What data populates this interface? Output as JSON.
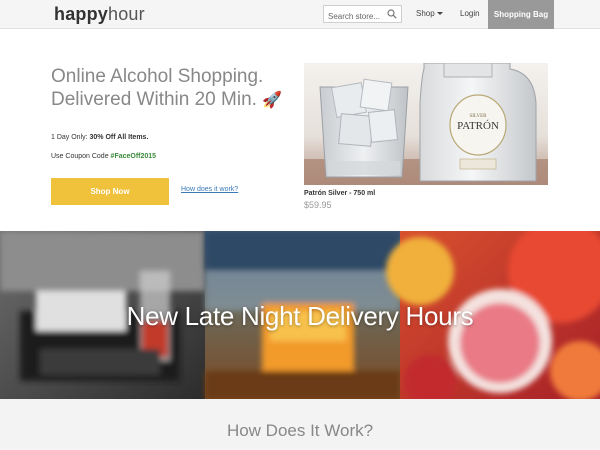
{
  "header": {
    "logo_bold": "happy",
    "logo_rest": "hour",
    "search_placeholder": "Search store...",
    "shop_label": "Shop",
    "login_label": "Login",
    "bag_label": "Shopping Bag"
  },
  "hero": {
    "headline_line1": "Online Alcohol Shopping.",
    "headline_line2": "Delivered Within 20 Min.",
    "rocket": "🚀",
    "promo_prefix": "1 Day Only: ",
    "promo_bold": "30% Off All Items.",
    "coupon_prefix": "Use Coupon Code ",
    "coupon_code": "#FaceOff2015",
    "shop_now_label": "Shop Now",
    "how_link_label": "How does it work?"
  },
  "product": {
    "name": "Patrón Silver - 750 ml",
    "price": "$59.95",
    "bottle_label": "PATRÓN"
  },
  "banner": {
    "title": "New Late Night Delivery Hours"
  },
  "section": {
    "how_title": "How Does It Work?"
  },
  "colors": {
    "accent_yellow": "#f0c13a",
    "bag_gray": "#999999",
    "coupon_green": "#3a8a3a",
    "link_blue": "#3a79b8"
  }
}
